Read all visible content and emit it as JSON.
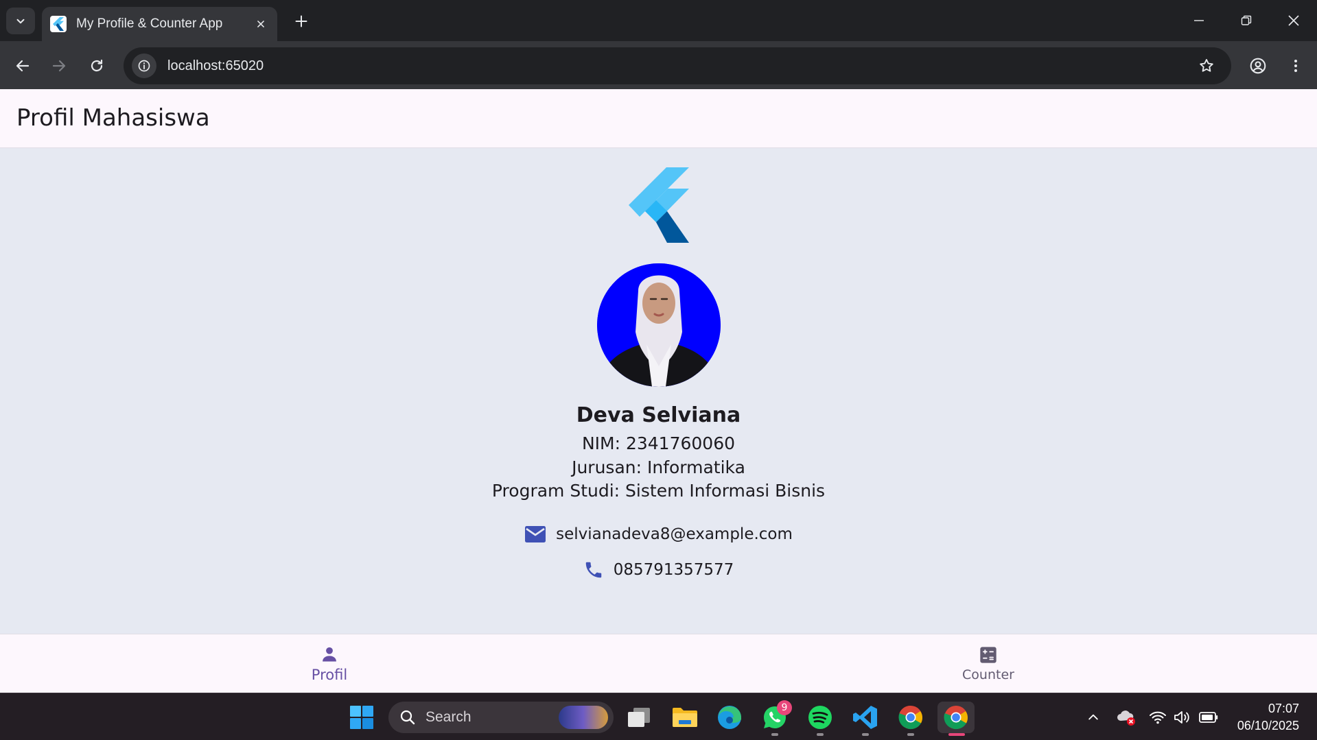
{
  "browser": {
    "tab_title": "My Profile & Counter App",
    "url": "localhost:65020"
  },
  "app": {
    "title": "Profil Mahasiswa",
    "profile": {
      "name": "Deva Selviana",
      "nim": "NIM: 2341760060",
      "jurusan": "Jurusan: Informatika",
      "prodi": "Program Studi: Sistem Informasi Bisnis",
      "email": "selvianadeva8@example.com",
      "phone": "085791357577"
    },
    "nav": {
      "profile_label": "Profil",
      "counter_label": "Counter",
      "active": "Profil"
    },
    "colors": {
      "primary": "#6750a4",
      "icon_blue": "#3f51b5",
      "avatar_bg": "#0000ff",
      "flutter_light": "#54c5f8",
      "flutter_dark": "#01579b"
    }
  },
  "taskbar": {
    "search_placeholder": "Search",
    "whatsapp_badge": "9",
    "time": "07:07",
    "date": "06/10/2025",
    "apps": [
      "windows-start-icon",
      "task-view-icon",
      "file-explorer-icon",
      "edge-icon",
      "whatsapp-icon",
      "spotify-icon",
      "vscode-icon",
      "chrome-icon",
      "chrome-active-icon"
    ]
  }
}
